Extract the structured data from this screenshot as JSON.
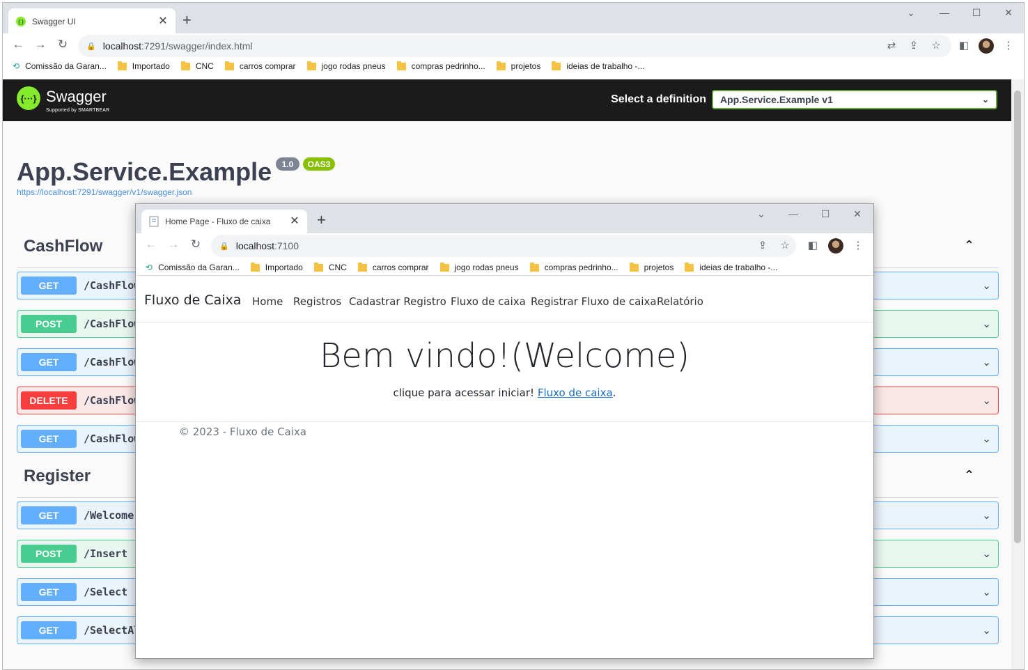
{
  "back_browser": {
    "tab_title": "Swagger UI",
    "url_host": "localhost",
    "url_path": ":7291/swagger/index.html",
    "bookmarks": [
      "Comissão da Garan...",
      "Importado",
      "CNC",
      "carros comprar",
      "jogo rodas pneus",
      "compras pedrinho...",
      "projetos",
      "ideias de trabalho -..."
    ]
  },
  "swagger": {
    "logo_text": "Swagger",
    "logo_sub": "Supported by SMARTBEAR",
    "select_label": "Select a definition",
    "selected_definition": "App.Service.Example v1",
    "title": "App.Service.Example",
    "version": "1.0",
    "oas": "OAS3",
    "json_link": "https://localhost:7291/swagger/v1/swagger.json",
    "sections": [
      {
        "name": "CashFlow",
        "operations": [
          {
            "method": "GET",
            "path": "/CashFlow"
          },
          {
            "method": "POST",
            "path": "/CashFlow"
          },
          {
            "method": "GET",
            "path": "/CashFlow"
          },
          {
            "method": "DELETE",
            "path": "/CashFlow"
          },
          {
            "method": "GET",
            "path": "/CashFlow"
          }
        ]
      },
      {
        "name": "Register",
        "operations": [
          {
            "method": "GET",
            "path": "/Welcome"
          },
          {
            "method": "POST",
            "path": "/Insert"
          },
          {
            "method": "GET",
            "path": "/Select"
          },
          {
            "method": "GET",
            "path": "/SelectAl"
          }
        ]
      }
    ],
    "colors": {
      "get": "#61affe",
      "post": "#49cc90",
      "delete": "#f93e3e",
      "topbar": "#1b1b1b",
      "logo": "#85ea2d"
    }
  },
  "front_browser": {
    "tab_title": "Home Page - Fluxo de caixa",
    "url_host": "localhost",
    "url_path": ":7100",
    "bookmarks": [
      "Comissão da Garan...",
      "Importado",
      "CNC",
      "carros comprar",
      "jogo rodas pneus",
      "compras pedrinho...",
      "projetos",
      "ideias de trabalho -..."
    ]
  },
  "fluxo": {
    "brand": "Fluxo de Caixa",
    "nav": [
      "Home",
      "Registros",
      "Cadastrar Registro",
      "Fluxo de caixa",
      "Registrar Fluxo de caixa",
      "Relatório"
    ],
    "heading": "Bem vindo!(Welcome)",
    "paragraph_text": "clique para acessar iniciar! ",
    "paragraph_link": "Fluxo de caixa",
    "paragraph_end": ".",
    "footer": "© 2023 - Fluxo de Caixa"
  },
  "icons": [
    "swagger-favicon-icon",
    "page-favicon-icon",
    "close-tab-icon",
    "new-tab-icon",
    "minimize-icon",
    "maximize-icon",
    "close-window-icon",
    "tab-search-icon",
    "back-icon",
    "forward-icon",
    "reload-icon",
    "lock-icon",
    "translate-icon",
    "share-icon",
    "star-icon",
    "side-panel-icon",
    "profile-avatar",
    "menu-icon",
    "folder-icon",
    "chevron-down-icon",
    "chevron-up-icon"
  ]
}
